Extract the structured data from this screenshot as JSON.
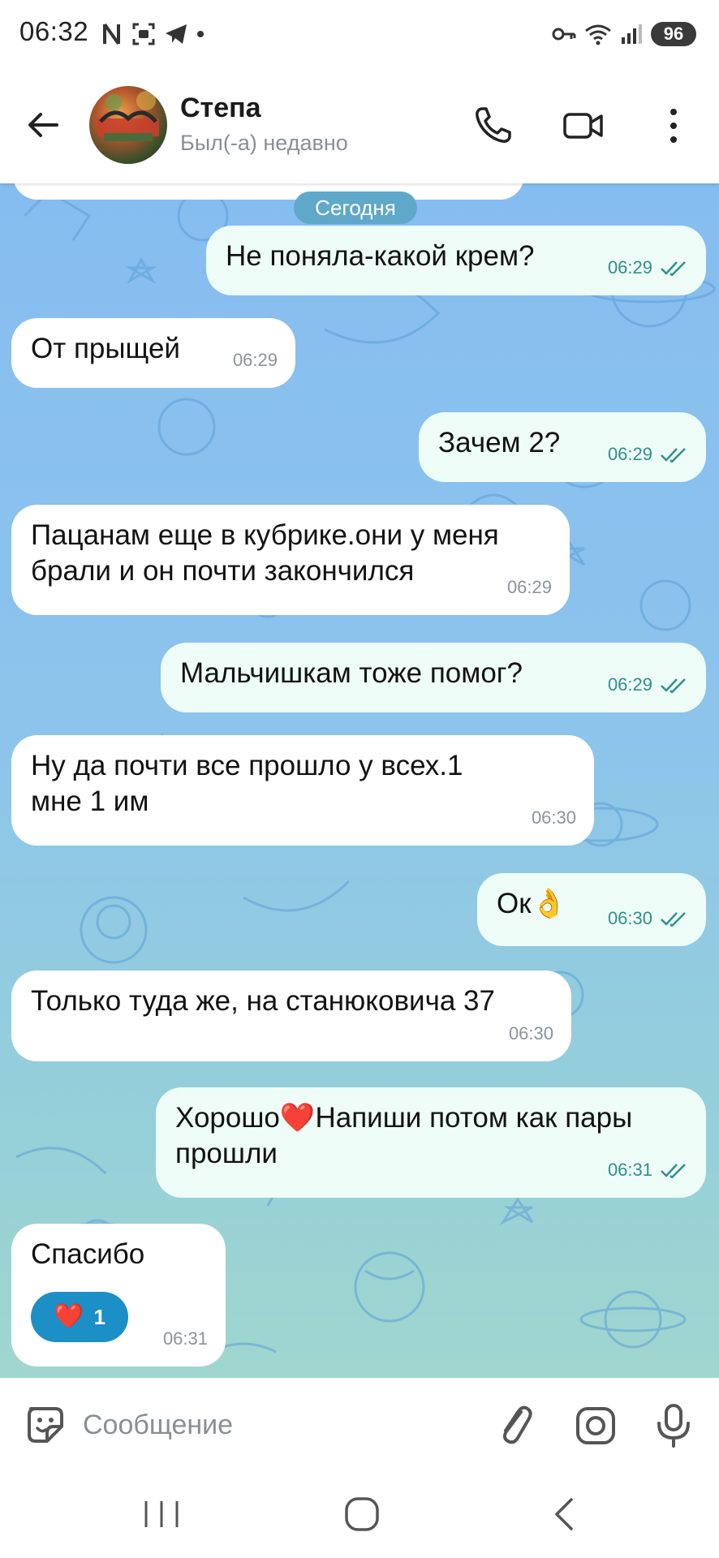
{
  "status_bar": {
    "time": "06:32",
    "battery": "96",
    "icons": [
      "n-badge-icon",
      "screen-capture-icon",
      "telegram-icon",
      "dot-icon",
      "key-icon",
      "wifi-icon",
      "signal-icon"
    ]
  },
  "header": {
    "name": "Степа",
    "status": "Был(-а) недавно",
    "icons": [
      "back-arrow-icon",
      "phone-icon",
      "video-camera-icon",
      "more-vertical-icon"
    ]
  },
  "chat": {
    "date_separator": "Сегодня",
    "messages": [
      {
        "dir": "out",
        "text": "Не поняла-какой крем?",
        "time": "06:29",
        "read": true
      },
      {
        "dir": "in",
        "text": "От прыщей",
        "time": "06:29"
      },
      {
        "dir": "out",
        "text": "Зачем 2?",
        "time": "06:29",
        "read": true
      },
      {
        "dir": "in",
        "text": "Пацанам еще в кубрике.они у меня брали и он почти закончился",
        "time": "06:29"
      },
      {
        "dir": "out",
        "text": "Мальчишкам тоже помог?",
        "time": "06:29",
        "read": true
      },
      {
        "dir": "in",
        "text": "Ну да почти все прошло у всех.1 мне 1 им",
        "time": "06:30"
      },
      {
        "dir": "out",
        "text": "Ок👌",
        "time": "06:30",
        "read": true
      },
      {
        "dir": "in",
        "text": "Только туда же, на станюковича 37",
        "time": "06:30"
      },
      {
        "dir": "out",
        "text": "Хорошо❤️Напиши потом как пары прошли",
        "time": "06:31",
        "read": true
      },
      {
        "dir": "in",
        "text": "Спасибо",
        "time": "06:31",
        "reaction": {
          "emoji": "❤️",
          "count": "1"
        }
      }
    ]
  },
  "composer": {
    "placeholder": "Сообщение",
    "icons": [
      "sticker-icon",
      "paperclip-icon",
      "camera-icon",
      "microphone-icon"
    ]
  },
  "nav": {
    "icons": [
      "recents-icon",
      "home-icon",
      "back-icon"
    ]
  },
  "colors": {
    "incoming_bubble": "#ffffff",
    "outgoing_bubble": "#eefdf7",
    "outgoing_meta": "#2f8f8e",
    "reaction_pill": "#1b8fc6",
    "date_pill": "#5fa8c9"
  }
}
